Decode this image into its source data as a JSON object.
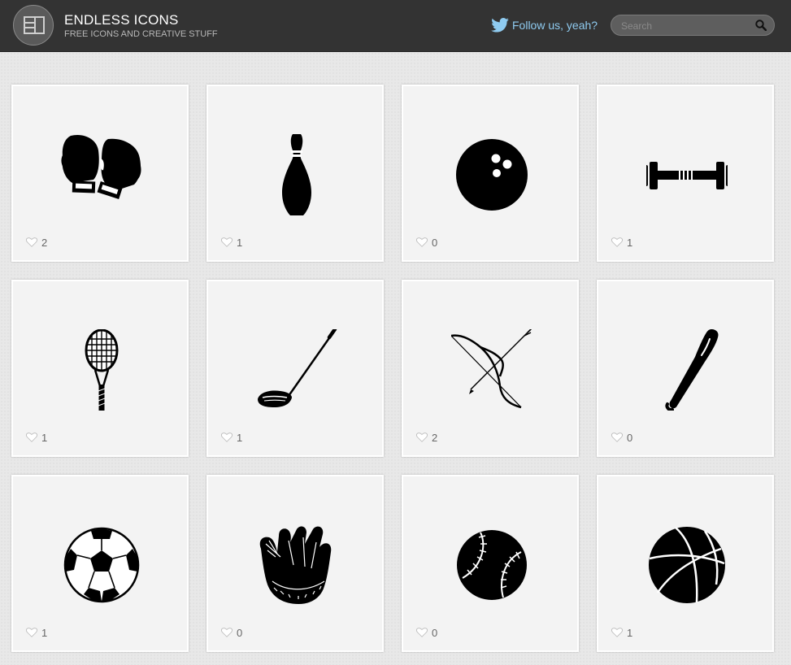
{
  "header": {
    "brand_title": "ENDLESS ICONS",
    "brand_subtitle": "FREE ICONS AND CREATIVE STUFF",
    "follow_label": "Follow us, yeah?",
    "search_placeholder": "Search",
    "colors": {
      "bar": "#333333",
      "follow": "#8fcbf0"
    }
  },
  "icons": [
    {
      "name": "boxing-gloves-icon",
      "likes": "2"
    },
    {
      "name": "bowling-pin-icon",
      "likes": "1"
    },
    {
      "name": "bowling-ball-icon",
      "likes": "0"
    },
    {
      "name": "dumbbell-icon",
      "likes": "1"
    },
    {
      "name": "tennis-racket-icon",
      "likes": "1"
    },
    {
      "name": "golf-club-icon",
      "likes": "1"
    },
    {
      "name": "bow-and-arrow-icon",
      "likes": "2"
    },
    {
      "name": "baseball-bat-icon",
      "likes": "0"
    },
    {
      "name": "soccer-ball-icon",
      "likes": "1"
    },
    {
      "name": "baseball-glove-icon",
      "likes": "0"
    },
    {
      "name": "baseball-icon",
      "likes": "0"
    },
    {
      "name": "basketball-icon",
      "likes": "1"
    }
  ]
}
